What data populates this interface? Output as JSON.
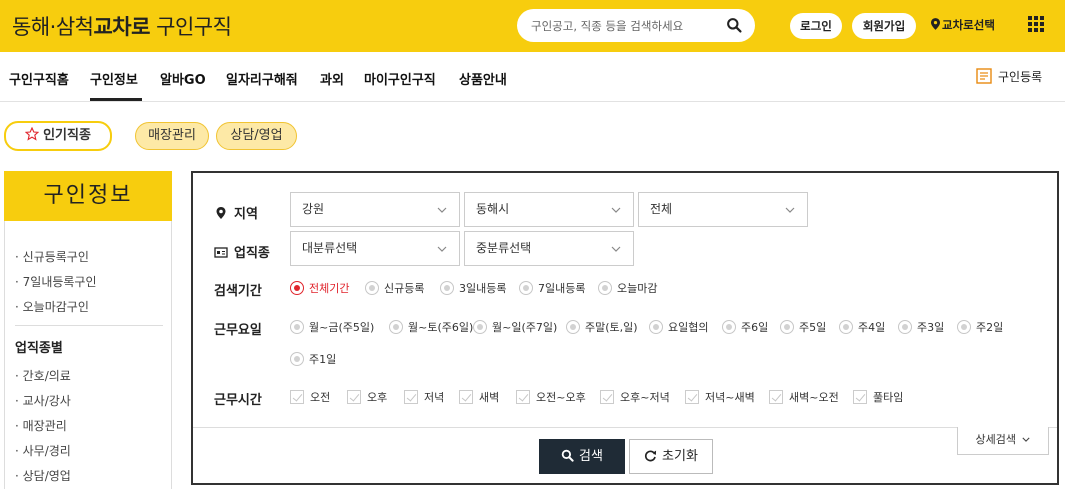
{
  "header": {
    "logo_prefix": "동해·삼척",
    "logo_brand": "교차로",
    "logo_suffix": "구인구직",
    "search_placeholder": "구인공고, 직종 등을 검색하세요",
    "login_label": "로그인",
    "signup_label": "회원가입",
    "location_label": "교차로선택",
    "brand_color": "#f7cd0e"
  },
  "nav": {
    "items": [
      "구인구직홈",
      "구인정보",
      "알바GO",
      "일자리구해줘",
      "과외",
      "마이구인구직",
      "상품안내"
    ],
    "active": "구인정보",
    "register_label": "구인등록"
  },
  "chips": {
    "popular_label": "인기직종",
    "items": [
      "매장관리",
      "상담/영업"
    ]
  },
  "sidebar": {
    "title": "구인정보",
    "links": [
      "신규등록구인",
      "7일내등록구인",
      "오늘마감구인"
    ],
    "section_heading": "업직종별",
    "section_links": [
      "간호/의료",
      "교사/강사",
      "매장관리",
      "사무/경리",
      "상담/영업"
    ]
  },
  "search": {
    "region_label": "지역",
    "region_selects": [
      "강원",
      "동해시",
      "전체"
    ],
    "job_label": "업직종",
    "job_selects": [
      "대분류선택",
      "중분류선택"
    ],
    "period_label": "검색기간",
    "period_options": [
      "전체기간",
      "신규등록",
      "3일내등록",
      "7일내등록",
      "오늘마감"
    ],
    "period_selected": "전체기간",
    "workday_label": "근무요일",
    "workday_options": [
      "월~금(주5일)",
      "월~토(주6일)",
      "월~일(주7일)",
      "주말(토,일)",
      "요일협의",
      "주6일",
      "주5일",
      "주4일",
      "주3일",
      "주2일",
      "주1일"
    ],
    "worktime_label": "근무시간",
    "worktime_options": [
      "오전",
      "오후",
      "저녁",
      "새벽",
      "오전~오후",
      "오후~저녁",
      "저녁~새벽",
      "새벽~오전",
      "풀타임"
    ],
    "search_button": "검색",
    "reset_button": "초기화",
    "detail_button": "상세검색",
    "accent_color": "#e0242c"
  }
}
